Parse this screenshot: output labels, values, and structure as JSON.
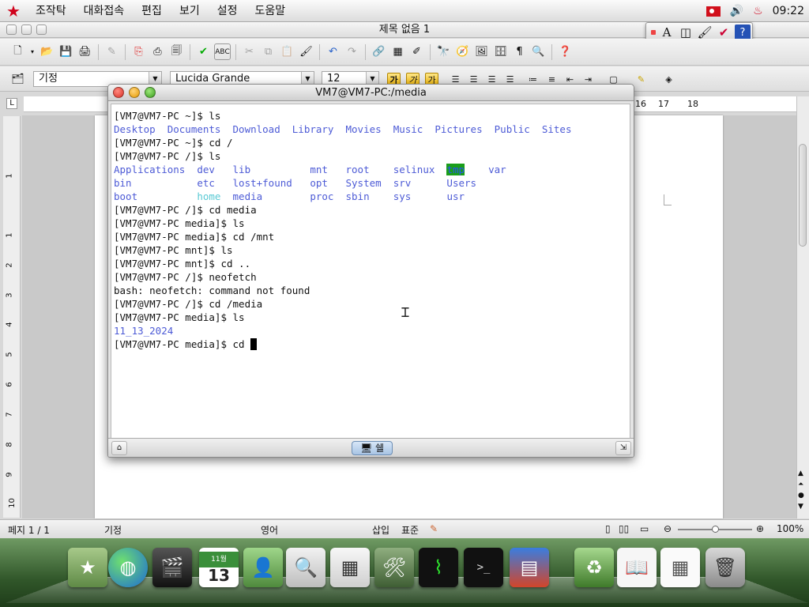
{
  "menubar": {
    "items": [
      "조작탁",
      "대화접속",
      "편집",
      "보기",
      "설정",
      "도움말"
    ],
    "clock": "09:22"
  },
  "document": {
    "title": "제목 없음 1",
    "style": "기정",
    "font": "Lucida Grande",
    "size": "12",
    "ruler_marks": [
      "16",
      "17",
      "18"
    ],
    "vruler_marks": [
      "1",
      "1",
      "2",
      "3",
      "4",
      "5",
      "6",
      "7",
      "8",
      "9",
      "10"
    ]
  },
  "statusbar": {
    "page": "페지  1 / 1",
    "style": "기정",
    "language": "영어",
    "insert_mode": "삽입",
    "selection_mode": "표준",
    "zoom": "100%",
    "zoom_level": 0.5
  },
  "terminal": {
    "title": "VM7@VM7-PC:/media",
    "tab_label": "쉘",
    "lines": [
      "[VM7@VM7-PC ~]$ ls",
      "Desktop  Documents  Download  Library  Movies  Music  Pictures  Public  Sites",
      "[VM7@VM7-PC ~]$ cd /",
      "[VM7@VM7-PC /]$ ls",
      "Applications  dev   lib          mnt   root    selinux  tmp    var",
      "bin           etc   lost+found   opt   System  srv      Users",
      "boot          home  media        proc  sbin    sys      usr",
      "[VM7@VM7-PC /]$ cd media",
      "[VM7@VM7-PC media]$ ls",
      "[VM7@VM7-PC media]$ cd /mnt",
      "[VM7@VM7-PC mnt]$ ls",
      "[VM7@VM7-PC mnt]$ cd ..",
      "[VM7@VM7-PC /]$ neofetch",
      "bash: neofetch: command not found",
      "[VM7@VM7-PC /]$ cd /media",
      "[VM7@VM7-PC media]$ ls",
      "11_13_2024",
      "[VM7@VM7-PC media]$ cd "
    ]
  },
  "dock": {
    "calendar_month": "11월",
    "calendar_day": "13"
  },
  "colors": {
    "terminal_dir": "#4d5bd6",
    "terminal_home": "#58c9d4",
    "terminal_tmp_bg": "#1a9e1a",
    "dock_green": "#31572a",
    "star_red": "#d0021b"
  }
}
